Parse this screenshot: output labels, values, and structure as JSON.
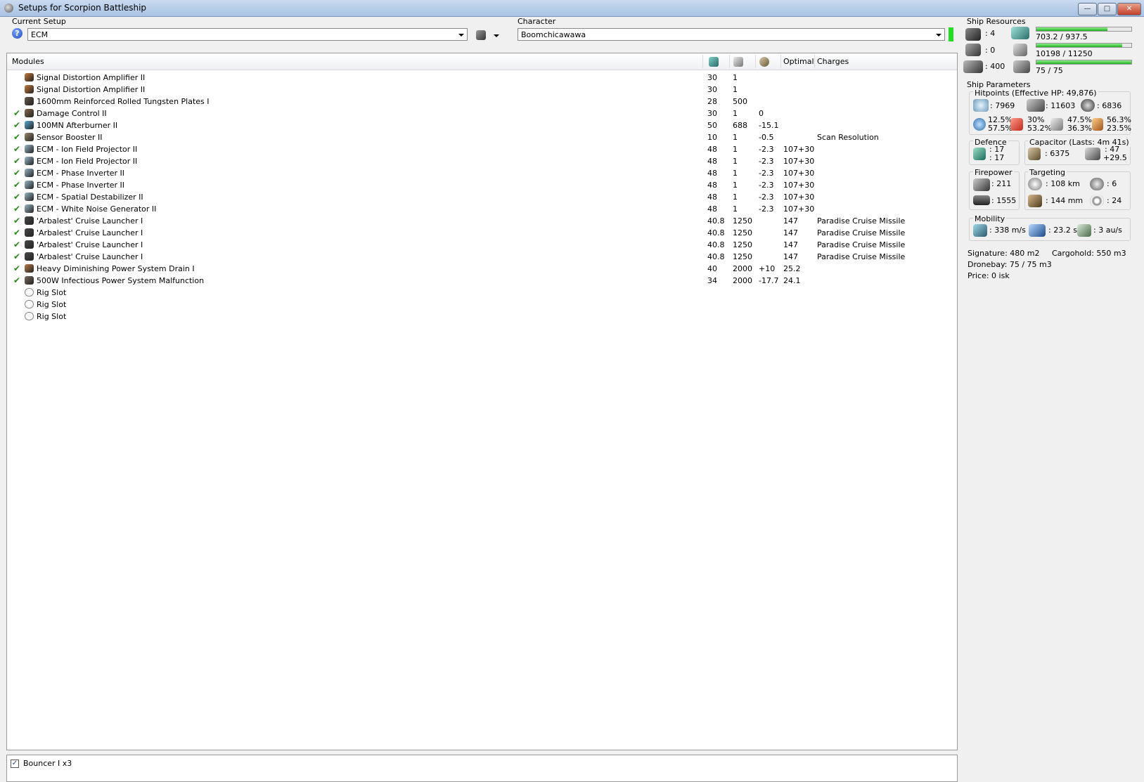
{
  "window": {
    "title": "Setups for Scorpion Battleship"
  },
  "setup": {
    "label": "Current Setup",
    "value": "ECM"
  },
  "character": {
    "label": "Character",
    "value": "Boomchicawawa"
  },
  "table": {
    "headers": {
      "modules": "Modules",
      "optimal": "Optimal",
      "charges": "Charges"
    },
    "rows": [
      {
        "name": "Signal Distortion Amplifier II",
        "cpu": "30",
        "pg": "1",
        "cap": "",
        "optimal": "",
        "charges": "",
        "active": false
      },
      {
        "name": "Signal Distortion Amplifier II",
        "cpu": "30",
        "pg": "1",
        "cap": "",
        "optimal": "",
        "charges": "",
        "active": false
      },
      {
        "name": "1600mm Reinforced Rolled Tungsten Plates I",
        "cpu": "28",
        "pg": "500",
        "cap": "",
        "optimal": "",
        "charges": "",
        "active": false
      },
      {
        "name": "Damage Control II",
        "cpu": "30",
        "pg": "1",
        "cap": "0",
        "optimal": "",
        "charges": "",
        "active": true
      },
      {
        "name": "100MN Afterburner II",
        "cpu": "50",
        "pg": "688",
        "cap": "-15.1",
        "optimal": "",
        "charges": "",
        "active": true
      },
      {
        "name": "Sensor Booster II",
        "cpu": "10",
        "pg": "1",
        "cap": "-0.5",
        "optimal": "",
        "charges": "Scan Resolution",
        "active": true
      },
      {
        "name": "ECM - Ion Field Projector II",
        "cpu": "48",
        "pg": "1",
        "cap": "-2.3",
        "optimal": "107+30",
        "charges": "",
        "active": true
      },
      {
        "name": "ECM - Ion Field Projector II",
        "cpu": "48",
        "pg": "1",
        "cap": "-2.3",
        "optimal": "107+30",
        "charges": "",
        "active": true
      },
      {
        "name": "ECM - Phase Inverter II",
        "cpu": "48",
        "pg": "1",
        "cap": "-2.3",
        "optimal": "107+30",
        "charges": "",
        "active": true
      },
      {
        "name": "ECM - Phase Inverter II",
        "cpu": "48",
        "pg": "1",
        "cap": "-2.3",
        "optimal": "107+30",
        "charges": "",
        "active": true
      },
      {
        "name": "ECM - Spatial Destabilizer II",
        "cpu": "48",
        "pg": "1",
        "cap": "-2.3",
        "optimal": "107+30",
        "charges": "",
        "active": true
      },
      {
        "name": "ECM - White Noise Generator II",
        "cpu": "48",
        "pg": "1",
        "cap": "-2.3",
        "optimal": "107+30",
        "charges": "",
        "active": true
      },
      {
        "name": "'Arbalest' Cruise Launcher I",
        "cpu": "40.8",
        "pg": "1250",
        "cap": "",
        "optimal": "147",
        "charges": "Paradise Cruise Missile",
        "active": true
      },
      {
        "name": "'Arbalest' Cruise Launcher I",
        "cpu": "40.8",
        "pg": "1250",
        "cap": "",
        "optimal": "147",
        "charges": "Paradise Cruise Missile",
        "active": true
      },
      {
        "name": "'Arbalest' Cruise Launcher I",
        "cpu": "40.8",
        "pg": "1250",
        "cap": "",
        "optimal": "147",
        "charges": "Paradise Cruise Missile",
        "active": true
      },
      {
        "name": "'Arbalest' Cruise Launcher I",
        "cpu": "40.8",
        "pg": "1250",
        "cap": "",
        "optimal": "147",
        "charges": "Paradise Cruise Missile",
        "active": true
      },
      {
        "name": "Heavy Diminishing Power System Drain I",
        "cpu": "40",
        "pg": "2000",
        "cap": "+10",
        "optimal": "25.2",
        "charges": "",
        "active": true
      },
      {
        "name": "500W Infectious Power System Malfunction",
        "cpu": "34",
        "pg": "2000",
        "cap": "-17.7",
        "optimal": "24.1",
        "charges": "",
        "active": true
      },
      {
        "name": "Rig Slot",
        "cpu": "",
        "pg": "",
        "cap": "",
        "optimal": "",
        "charges": "",
        "active": false
      },
      {
        "name": "Rig Slot",
        "cpu": "",
        "pg": "",
        "cap": "",
        "optimal": "",
        "charges": "",
        "active": false
      },
      {
        "name": "Rig Slot",
        "cpu": "",
        "pg": "",
        "cap": "",
        "optimal": "",
        "charges": "",
        "active": false
      }
    ]
  },
  "drones": {
    "item": "Bouncer I x3"
  },
  "resources": {
    "title": "Ship Resources",
    "turret_hardpoints": ": 4",
    "launcher_hardpoints": ": 0",
    "calibration": ": 400",
    "cpu_text": "703.2 / 937.5",
    "cpu_fraction": 0.75,
    "powergrid_text": "10198 / 11250",
    "powergrid_fraction": 0.906,
    "calibration_text": "75 / 75",
    "calibration_fraction": 1.0
  },
  "params": {
    "title": "Ship Parameters",
    "hitpoints_title": "Hitpoints (Effective HP: 49,876)",
    "shield_hp": ": 7969",
    "armor_hp": ": 11603",
    "structure_hp": ": 6836",
    "res_em_top": "12.5%",
    "res_em_bottom": "57.5%",
    "res_th_top": "30%",
    "res_th_bottom": "53.2%",
    "res_ki_top": "47.5%",
    "res_ki_bottom": "36.3%",
    "res_ex_top": "56.3%",
    "res_ex_bottom": "23.5%",
    "defence_title": "Defence",
    "defence_top": ": 17",
    "defence_bottom": ": 17",
    "capacitor_title": "Capacitor (Lasts: 4m 41s)",
    "cap_amount": ": 6375",
    "cap_rate_top": ": 47",
    "cap_rate_bottom": "+29.5",
    "firepower_title": "Firepower",
    "dps": ": 211",
    "volley": ": 1555",
    "targeting_title": "Targeting",
    "target_range": ": 108 km",
    "max_targets": ": 6",
    "scan_res": ": 144 mm",
    "sensor_strength": ": 24",
    "mobility_title": "Mobility",
    "speed": ": 338 m/s",
    "align_time": ": 23.2 s",
    "warp_speed": ": 3 au/s",
    "signature": "Signature: 480 m2",
    "cargohold": "Cargohold: 550 m3",
    "dronebay": "Dronebay: 75 / 75 m3",
    "price": "Price: 0 isk"
  }
}
